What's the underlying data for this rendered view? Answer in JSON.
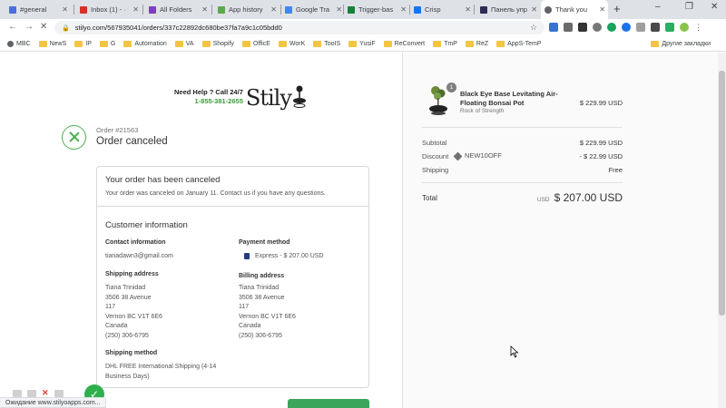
{
  "tabs": [
    {
      "label": "#general",
      "color": "#4a6ee0"
    },
    {
      "label": "Inbox (1) - ·",
      "color": "#d93025"
    },
    {
      "label": "All Folders",
      "color": "#7b3fbf"
    },
    {
      "label": "App historу",
      "color": "#5aa94c"
    },
    {
      "label": "Google Tra",
      "color": "#4285f4"
    },
    {
      "label": "Trigger-bas",
      "color": "#188038"
    },
    {
      "label": "Crisp",
      "color": "#1972f5"
    },
    {
      "label": "Панель упр",
      "color": "#2c2c54"
    },
    {
      "label": "Thank you",
      "color": "#5f6368"
    }
  ],
  "address": {
    "url": "stilyo.com/567935041/orders/337c22892dc680be37fa7a9c1c05bdd0"
  },
  "bookmarks": {
    "items": [
      "MBC",
      "NewS",
      "IP",
      "G",
      "Automation",
      "VA",
      "Shopify",
      "OfficE",
      "WorK",
      "TooIS",
      "YusiF",
      "ReConvert",
      "TmP",
      "ReZ",
      "AppS-TemP"
    ],
    "other": "Другие закладки"
  },
  "header": {
    "help_line": "Need Help ? Call 24/7",
    "phone": "1-855-381-2655",
    "brand": "Stily"
  },
  "order": {
    "number": "Order #21563",
    "title": "Order canceled"
  },
  "cancel_box": {
    "heading": "Your order has been canceled",
    "message": "Your order was canceled on January 11. Contact us if you have any questions."
  },
  "customer": {
    "heading": "Customer information",
    "contact_label": "Contact information",
    "contact_value": "tianadawn3@gmail.com",
    "payment_label": "Payment method",
    "payment_value": "Express - $ 207.00 USD",
    "shipping_label": "Shipping address",
    "shipping_lines": [
      "Tiana Trinidad",
      "3506 38 Avenue",
      "117",
      "Vernon BC V1T 6E6",
      "Canada",
      "(250) 306-6795"
    ],
    "billing_label": "Billing address",
    "billing_lines": [
      "Tiana Trinidad",
      "3506 38 Avenue",
      "117",
      "Vernon BC V1T 6E6",
      "Canada",
      "(250) 306-6795"
    ],
    "method_label": "Shipping method",
    "method_value": "DHL FREE International Shipping (4-14 Business Days)"
  },
  "summary": {
    "product_qty": "1",
    "product_name": "Black Eye Base Levitating Air-Floating Bonsai Pot",
    "product_variant": "Rock of Strength",
    "product_price": "$ 229.99 USD",
    "subtotal_label": "Subtotal",
    "subtotal_value": "$ 229.99 USD",
    "discount_label": "Discount",
    "discount_code": "NEW10OFF",
    "discount_value": "- $ 22.99 USD",
    "shipping_label": "Shipping",
    "shipping_value": "Free",
    "total_label": "Total",
    "total_currency": "USD",
    "total_value": "$ 207.00 USD"
  },
  "status": {
    "text": "Ожидание www.stilyoapps.com..."
  }
}
